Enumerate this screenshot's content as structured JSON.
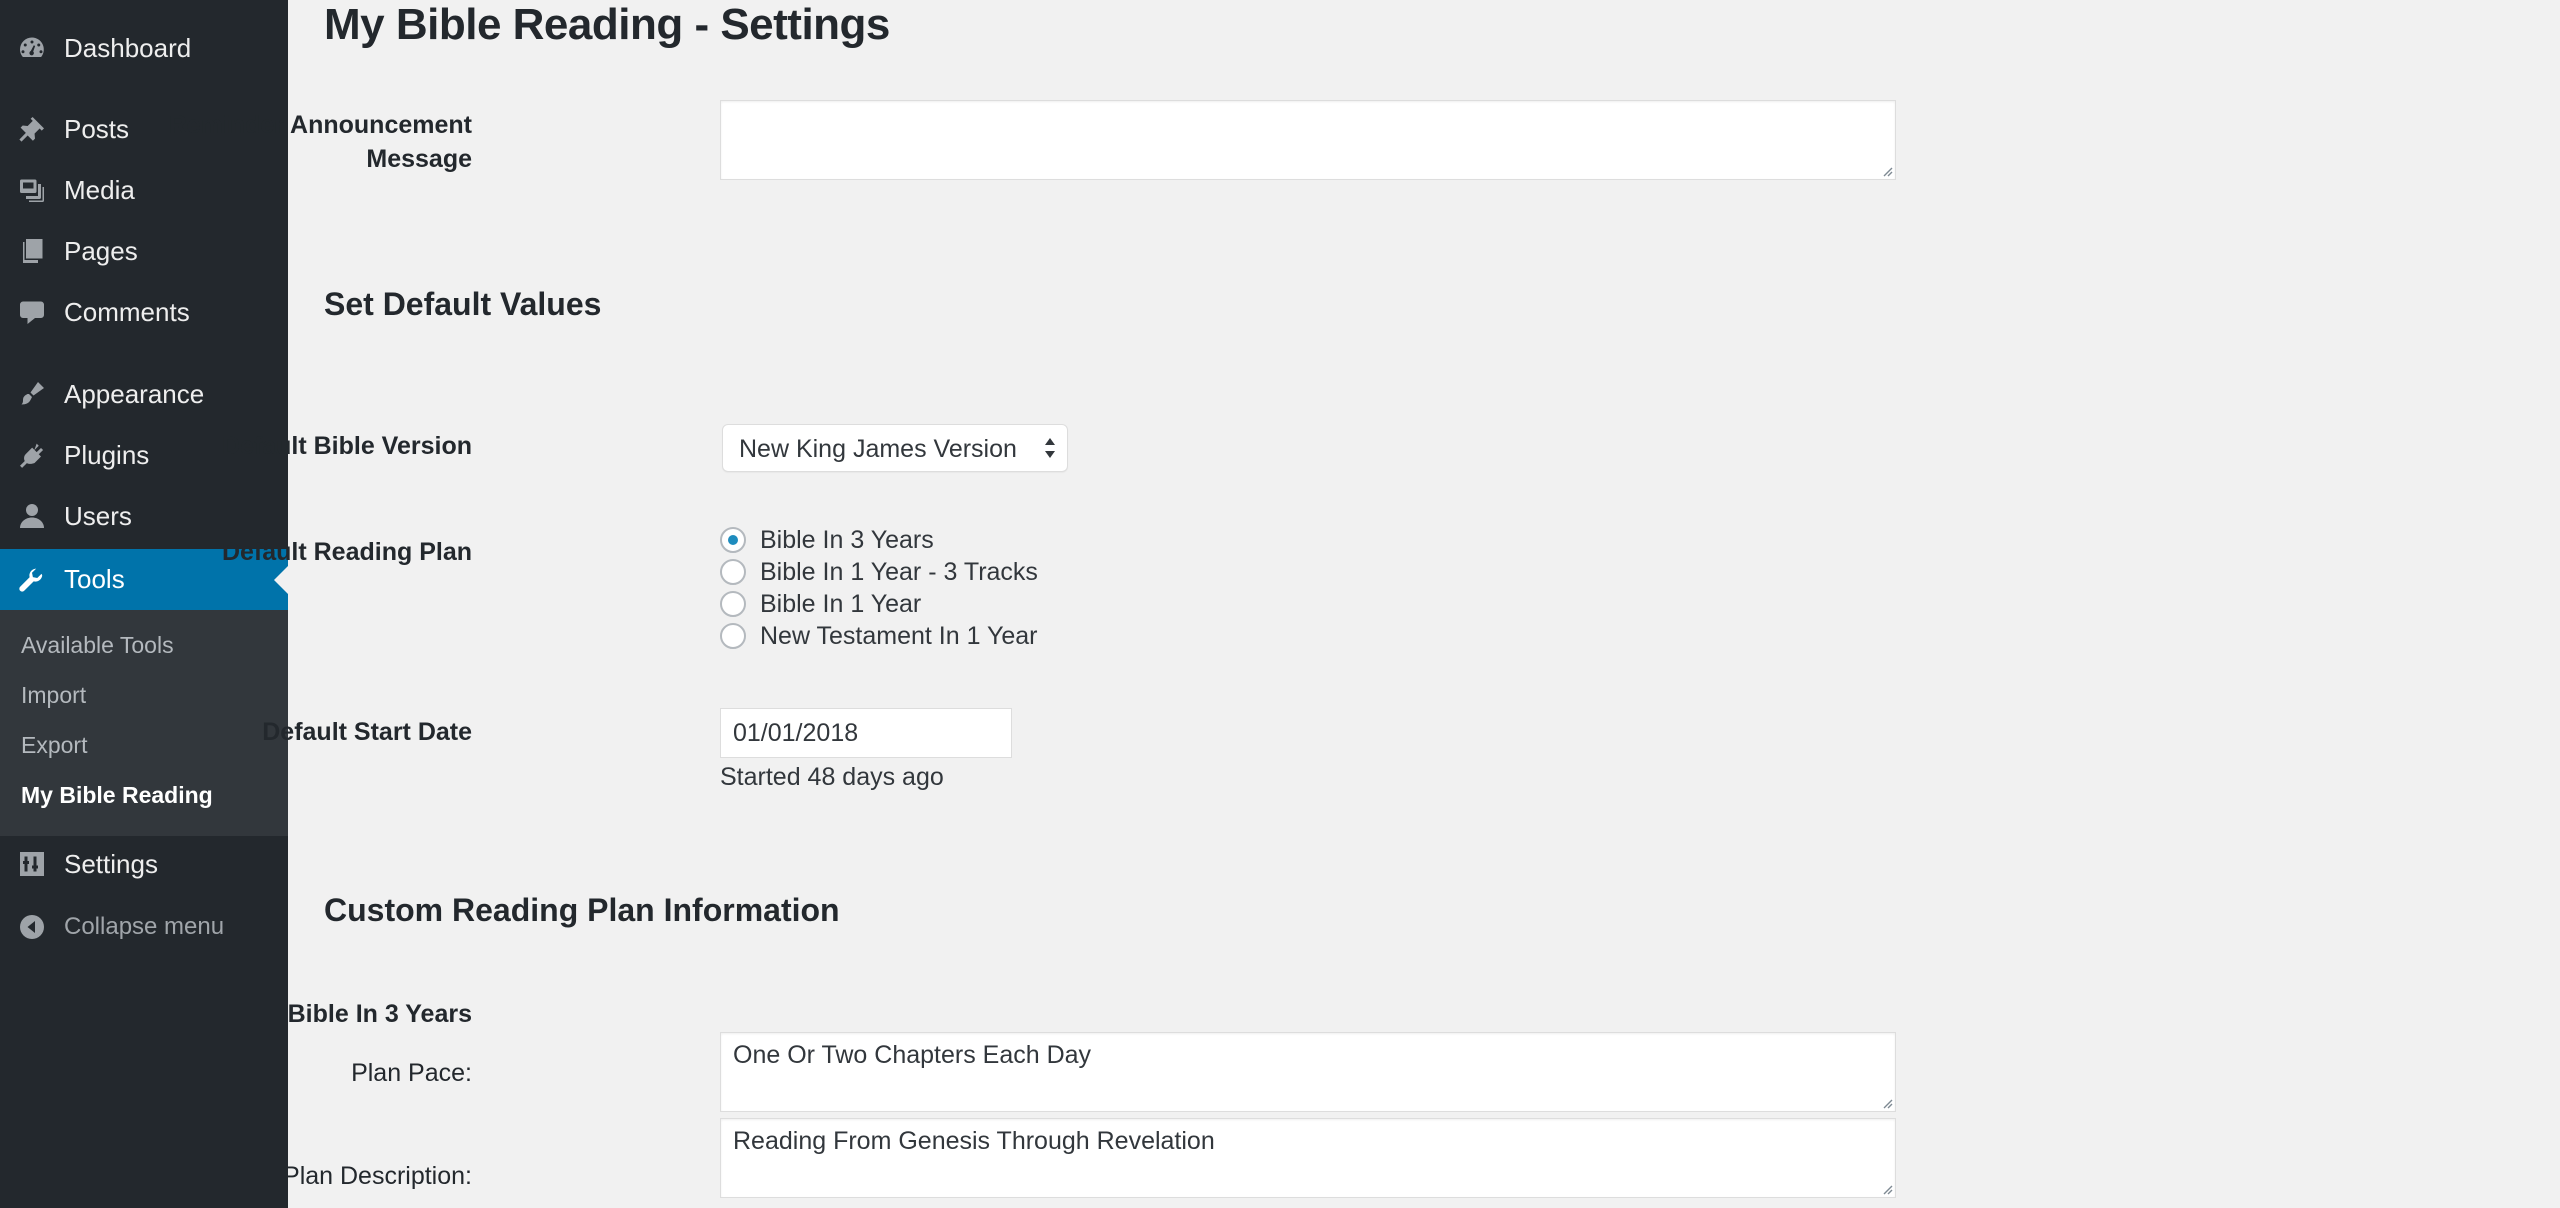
{
  "sidebar": {
    "items": [
      {
        "label": "Dashboard",
        "icon": "dashboard-icon"
      },
      {
        "label": "Posts",
        "icon": "pin-icon"
      },
      {
        "label": "Media",
        "icon": "media-icon"
      },
      {
        "label": "Pages",
        "icon": "pages-icon"
      },
      {
        "label": "Comments",
        "icon": "comment-icon"
      },
      {
        "label": "Appearance",
        "icon": "paintbrush-icon"
      },
      {
        "label": "Plugins",
        "icon": "plug-icon"
      },
      {
        "label": "Users",
        "icon": "user-icon"
      },
      {
        "label": "Tools",
        "icon": "wrench-icon",
        "active": true
      },
      {
        "label": "Settings",
        "icon": "settings-icon"
      }
    ],
    "submenu": [
      {
        "label": "Available Tools"
      },
      {
        "label": "Import"
      },
      {
        "label": "Export"
      },
      {
        "label": "My Bible Reading",
        "current": true
      }
    ],
    "collapse_label": "Collapse menu"
  },
  "page": {
    "title": "My Bible Reading - Settings"
  },
  "reminder": {
    "label": "Reminder Announcement Message",
    "value": ""
  },
  "defaults": {
    "section_title": "Set Default Values",
    "bible_version": {
      "label": "Default Bible Version",
      "selected": "New King James Version"
    },
    "reading_plan": {
      "label": "Default Reading Plan",
      "options": [
        {
          "label": "Bible In 3 Years",
          "checked": true
        },
        {
          "label": "Bible In 1 Year - 3 Tracks",
          "checked": false
        },
        {
          "label": "Bible In 1 Year",
          "checked": false
        },
        {
          "label": "New Testament In 1 Year",
          "checked": false
        }
      ]
    },
    "start_date": {
      "label": "Default Start Date",
      "value": "01/01/2018",
      "helper": "Started 48 days ago"
    }
  },
  "custom": {
    "section_title": "Custom Reading Plan Information",
    "plan_name": "Bible In 3 Years",
    "pace_label": "Plan Pace:",
    "pace_value": "One Or Two Chapters Each Day",
    "description_label": "Plan Description:",
    "description_value": "Reading From Genesis Through Revelation"
  },
  "colors": {
    "sidebar_bg": "#23282d",
    "submenu_bg": "#32373c",
    "active_bg": "#0073aa",
    "content_bg": "#f1f1f1",
    "radio_checked": "#1e8cbe"
  }
}
